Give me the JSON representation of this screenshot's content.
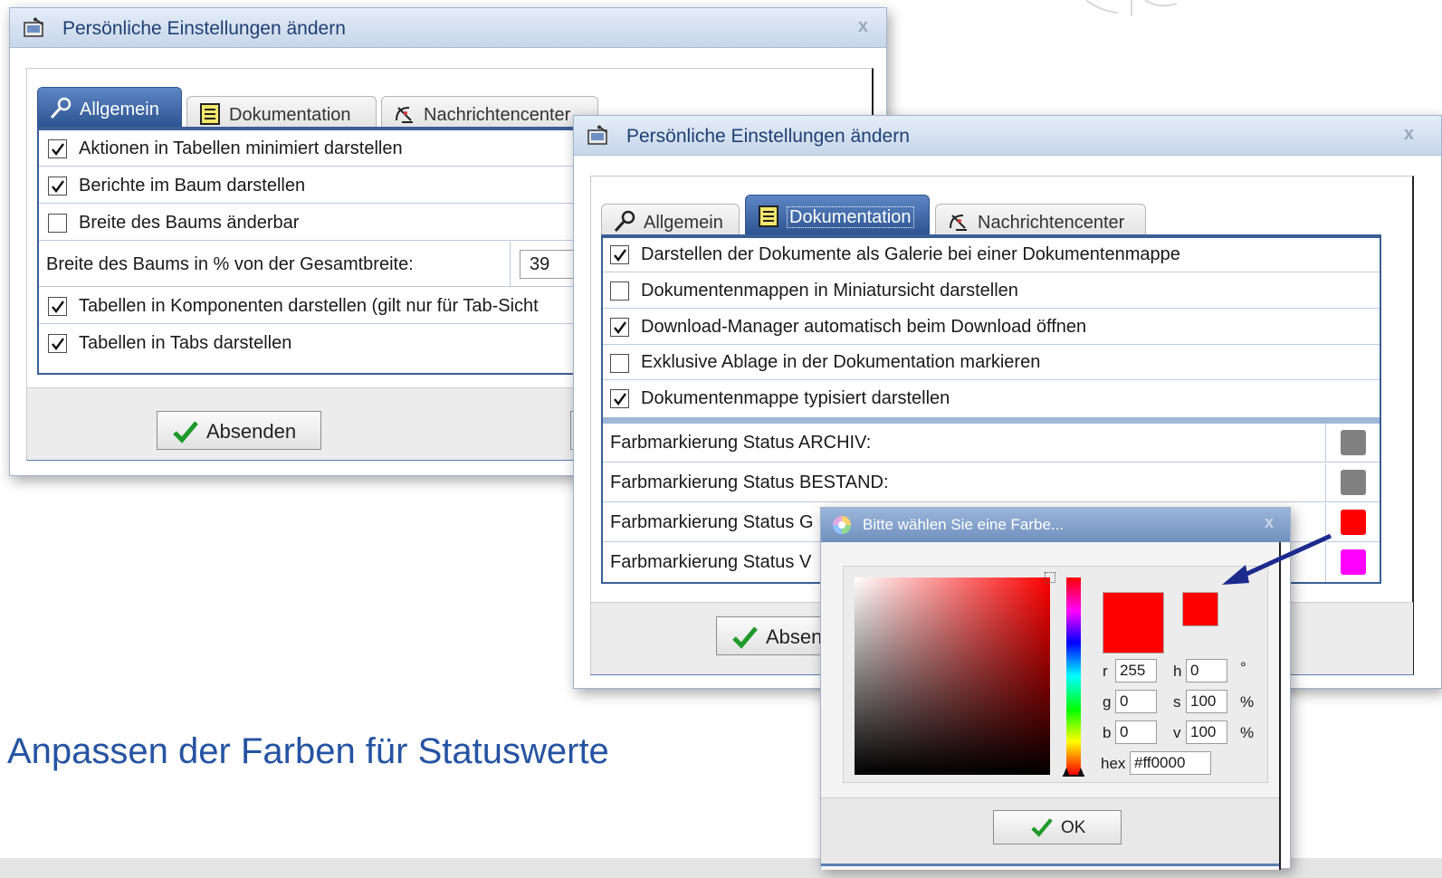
{
  "caption": "Anpassen der Farben für Statuswerte",
  "dialog1": {
    "title": "Persönliche Einstellungen ändern",
    "close_label": "x",
    "tabs": [
      "Allgemein",
      "Dokumentation",
      "Nachrichtencenter"
    ],
    "active_tab": "Allgemein",
    "options": [
      {
        "label": "Aktionen in Tabellen minimiert darstellen",
        "checked": true
      },
      {
        "label": "Berichte im Baum darstellen",
        "checked": true
      },
      {
        "label": "Breite des Baums änderbar",
        "checked": false
      }
    ],
    "width_field": {
      "label": "Breite des Baums in % von der Gesamtbreite:",
      "value": "39"
    },
    "options2": [
      {
        "label": "Tabellen in Komponenten darstellen (gilt nur für Tab-Sicht",
        "checked": true
      },
      {
        "label": "Tabellen in Tabs darstellen",
        "checked": true
      }
    ],
    "submit_label": "Absenden"
  },
  "dialog2": {
    "title": "Persönliche Einstellungen ändern",
    "close_label": "x",
    "tabs": [
      "Allgemein",
      "Dokumentation",
      "Nachrichtencenter"
    ],
    "active_tab": "Dokumentation",
    "options": [
      {
        "label": "Darstellen der Dokumente als Galerie bei einer Dokumentenmappe",
        "checked": true
      },
      {
        "label": "Dokumentenmappen in Miniatursicht darstellen",
        "checked": false
      },
      {
        "label": "Download-Manager automatisch beim Download öffnen",
        "checked": true
      },
      {
        "label": "Exklusive Ablage in der Dokumentation markieren",
        "checked": false
      },
      {
        "label": "Dokumentenmappe typisiert darstellen",
        "checked": true
      }
    ],
    "color_rows": [
      {
        "label": "Farbmarkierung Status ARCHIV:",
        "color": "#808080"
      },
      {
        "label": "Farbmarkierung Status BESTAND:",
        "color": "#808080"
      },
      {
        "label": "Farbmarkierung Status G",
        "color": "#ff0000"
      },
      {
        "label": "Farbmarkierung Status V",
        "color": "#ff00ff"
      }
    ],
    "submit_label": "Absen"
  },
  "color_picker": {
    "title": "Bitte wählen Sie eine Farbe...",
    "close_label": "x",
    "r_label": "r",
    "r": "255",
    "g_label": "g",
    "g": "0",
    "b_label": "b",
    "b": "0",
    "h_label": "h",
    "h": "0",
    "h_unit": "°",
    "s_label": "s",
    "s": "100",
    "s_unit": "%",
    "v_label": "v",
    "v": "100",
    "v_unit": "%",
    "hex_label": "hex",
    "hex": "#ff0000",
    "current_color": "#ff0000",
    "ok_label": "OK"
  }
}
